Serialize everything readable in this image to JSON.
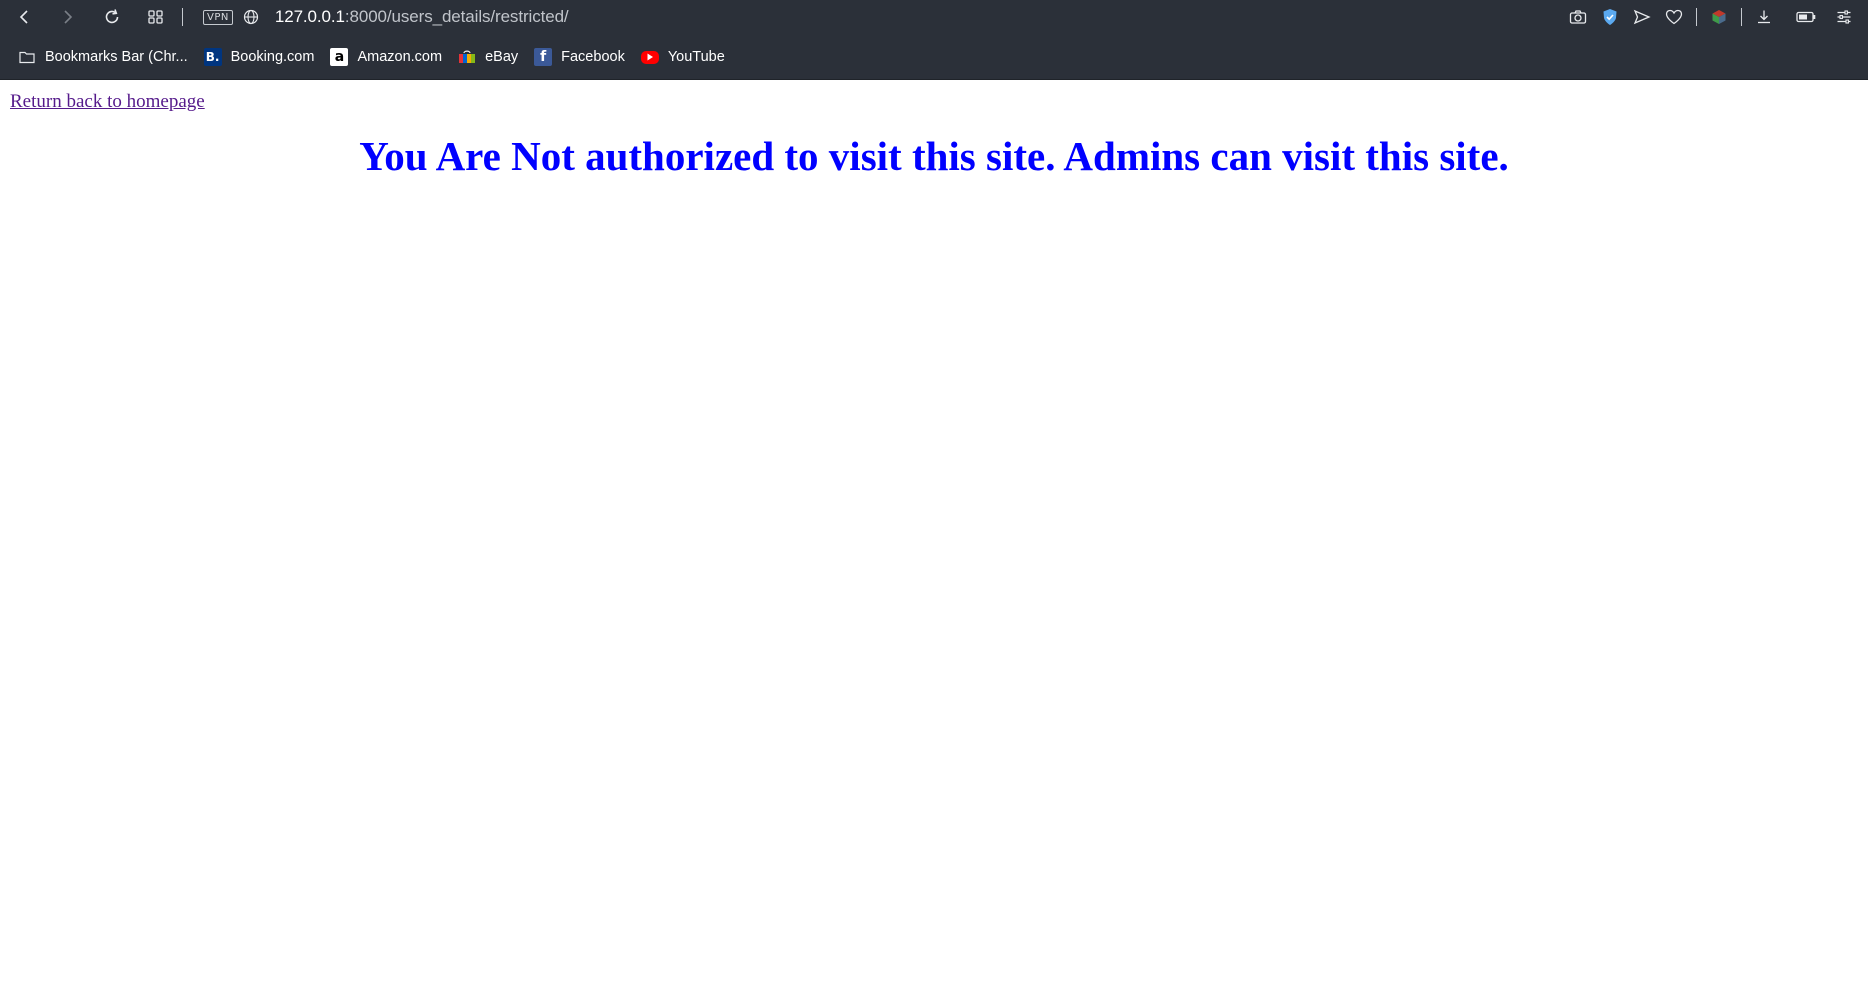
{
  "browser": {
    "url_host": "127.0.0.1",
    "url_rest": ":8000/users_details/restricted/",
    "vpn_label": "VPN",
    "bookmarks": [
      {
        "label": "Bookmarks Bar (Chr...",
        "icon": "folder-icon"
      },
      {
        "label": "Booking.com",
        "icon": "booking-icon",
        "glyph": "B."
      },
      {
        "label": "Amazon.com",
        "icon": "amazon-icon",
        "glyph": "a"
      },
      {
        "label": "eBay",
        "icon": "ebay-icon"
      },
      {
        "label": "Facebook",
        "icon": "facebook-icon",
        "glyph": "f"
      },
      {
        "label": "YouTube",
        "icon": "youtube-icon"
      }
    ]
  },
  "page": {
    "return_link": "Return back to homepage",
    "heading": "You Are Not authorized to visit this site. Admins can visit this site."
  },
  "colors": {
    "chrome_bg": "#2b3039",
    "heading": "#0000ff",
    "link_visited": "#551a8b"
  }
}
